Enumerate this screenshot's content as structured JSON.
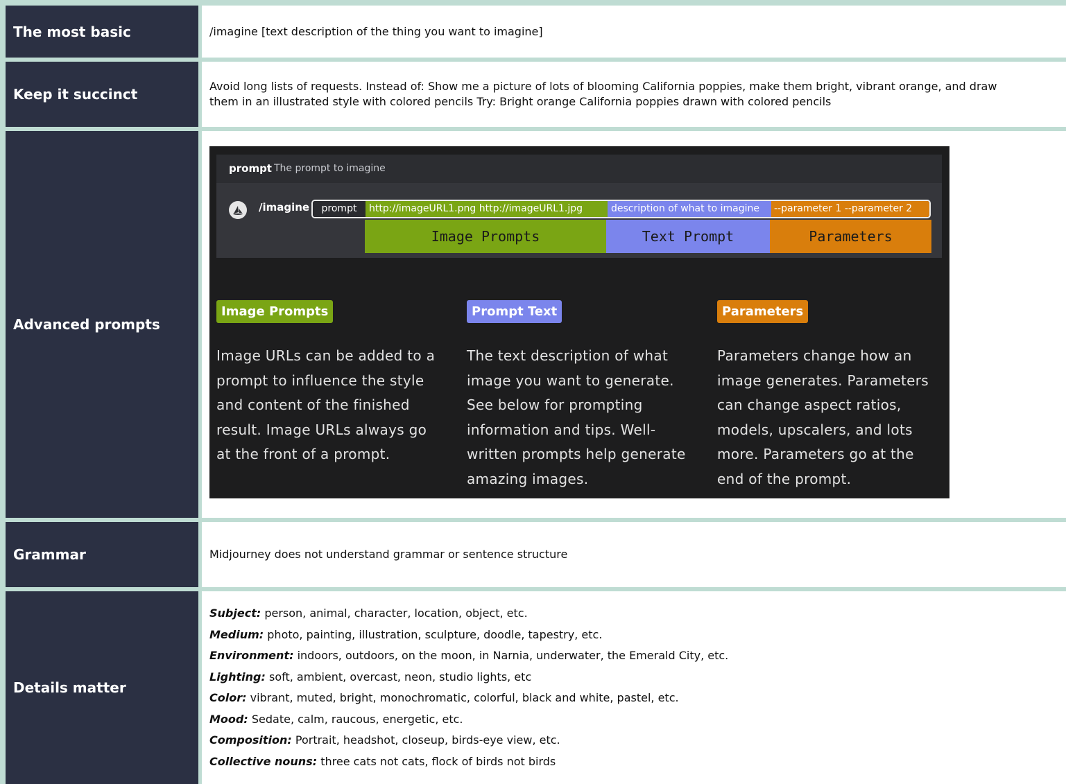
{
  "rows": [
    {
      "label": "The most basic",
      "content": "/imagine [text description of the thing you want to imagine]"
    },
    {
      "label": "Keep it succinct",
      "content": "Avoid long lists of requests. Instead of: Show me a picture of lots of blooming California poppies, make them bright, vibrant orange, and draw them in an illustrated style with colored pencils Try: Bright orange California poppies drawn with colored pencils"
    },
    {
      "label": "Advanced prompts"
    },
    {
      "label": "Grammar",
      "content": "Midjourney does not understand grammar or sentence structure"
    },
    {
      "label": "Details matter"
    }
  ],
  "advanced": {
    "prompt_name": "prompt",
    "prompt_desc": "The prompt to imagine",
    "command": "/imagine",
    "seg_prompt": "prompt",
    "seg_urls": "http://imageURL1.png   http://imageURL1.jpg",
    "seg_desc": "description of what to imagine",
    "seg_params": "--parameter 1   --parameter 2",
    "bar_image": "Image Prompts",
    "bar_text": "Text Prompt",
    "bar_params": "Parameters",
    "columns": [
      {
        "badge": "Image Prompts",
        "color": "#7aa514",
        "text": "Image URLs can be added to a prompt to influence the style and content of the finished result. Image URLs always go at the front of a prompt."
      },
      {
        "badge": "Prompt Text",
        "color": "#7b85ec",
        "text": "The text description of what image you want to generate. See below for prompting information and tips. Well-written prompts help generate amazing images."
      },
      {
        "badge": "Parameters",
        "color": "#d97e0c",
        "text": "Parameters change how an image generates. Parameters can change aspect ratios, models, upscalers, and lots more. Parameters go at the end of the prompt."
      }
    ]
  },
  "details": [
    {
      "key": "Subject:",
      "value": "person, animal, character, location, object, etc."
    },
    {
      "key": "Medium:",
      "value": "photo, painting, illustration, sculpture, doodle, tapestry, etc."
    },
    {
      "key": "Environment:",
      "value": "indoors, outdoors, on the moon, in Narnia, underwater, the Emerald City, etc."
    },
    {
      "key": "Lighting:",
      "value": "soft, ambient, overcast, neon, studio lights, etc"
    },
    {
      "key": "Color:",
      "value": "vibrant, muted, bright, monochromatic, colorful, black and white, pastel, etc."
    },
    {
      "key": "Mood:",
      "value": "Sedate, calm, raucous, energetic, etc."
    },
    {
      "key": "Composition:",
      "value": "Portrait, headshot, closeup, birds-eye view, etc."
    },
    {
      "key": "Collective nouns:",
      "value": "three cats not cats, flock of birds not birds"
    }
  ]
}
